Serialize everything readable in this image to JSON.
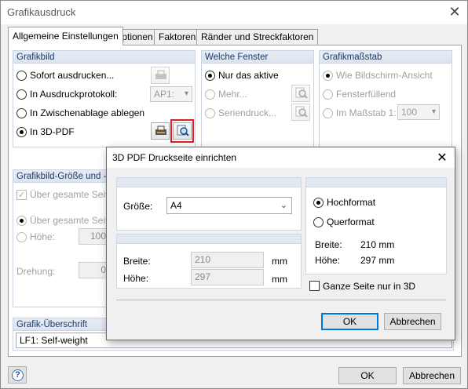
{
  "window": {
    "title": "Grafikausdruck",
    "close_glyph": "✕"
  },
  "tabs": [
    {
      "label": "Allgemeine Einstellungen"
    },
    {
      "label": "Optionen"
    },
    {
      "label": "Faktoren"
    },
    {
      "label": "Ränder und Streckfaktoren"
    }
  ],
  "grafikbild": {
    "header": "Grafikbild",
    "options": [
      {
        "label": "Sofort ausdrucken..."
      },
      {
        "label": "In Ausdruckprotokoll:"
      },
      {
        "label": "In Zwischenablage ablegen"
      },
      {
        "label": "In 3D-PDF"
      }
    ],
    "protocol_combo": "AP1:"
  },
  "welche_fenster": {
    "header": "Welche Fenster",
    "options": [
      {
        "label": "Nur das aktive"
      },
      {
        "label": "Mehr..."
      },
      {
        "label": "Seriendruck..."
      }
    ]
  },
  "massstab": {
    "header": "Grafikmaßstab",
    "options": [
      {
        "label": "Wie Bildschirm-Ansicht"
      },
      {
        "label": "Fensterfüllend"
      },
      {
        "label": "Im Maßstab 1:"
      }
    ],
    "scale_value": "100"
  },
  "groesse": {
    "header": "Grafikbild-Größe und -D",
    "checkbox_label": "Über gesamte Seiten",
    "radio1_label": "Über gesamte Seiten",
    "hoehe_label": "Höhe:",
    "hoehe_value": "100",
    "drehung_label": "Drehung:",
    "drehung_value": "0"
  },
  "ueberschrift": {
    "header": "Grafik-Überschrift",
    "value": "LF1: Self-weight"
  },
  "footer": {
    "help_glyph": "?",
    "ok_label": "OK",
    "cancel_label": "Abbrechen"
  },
  "dialog": {
    "title": "3D PDF Druckseite einrichten",
    "close_glyph": "✕",
    "groesse_label": "Größe:",
    "groesse_value": "A4",
    "breite_label": "Breite:",
    "breite_value": "210",
    "breite_unit": "mm",
    "hoehe_label": "Höhe:",
    "hoehe_value": "297",
    "hoehe_unit": "mm",
    "hochformat_label": "Hochformat",
    "querformat_label": "Querformat",
    "info_breite_label": "Breite:",
    "info_breite_value": "210 mm",
    "info_hoehe_label": "Höhe:",
    "info_hoehe_value": "297 mm",
    "ganze_seite_label": "Ganze Seite nur in 3D",
    "ok_label": "OK",
    "cancel_label": "Abbrechen"
  },
  "colors": {
    "accent": "#0078d7",
    "highlight_border": "#e02020",
    "group_header": "#dce4ef"
  }
}
